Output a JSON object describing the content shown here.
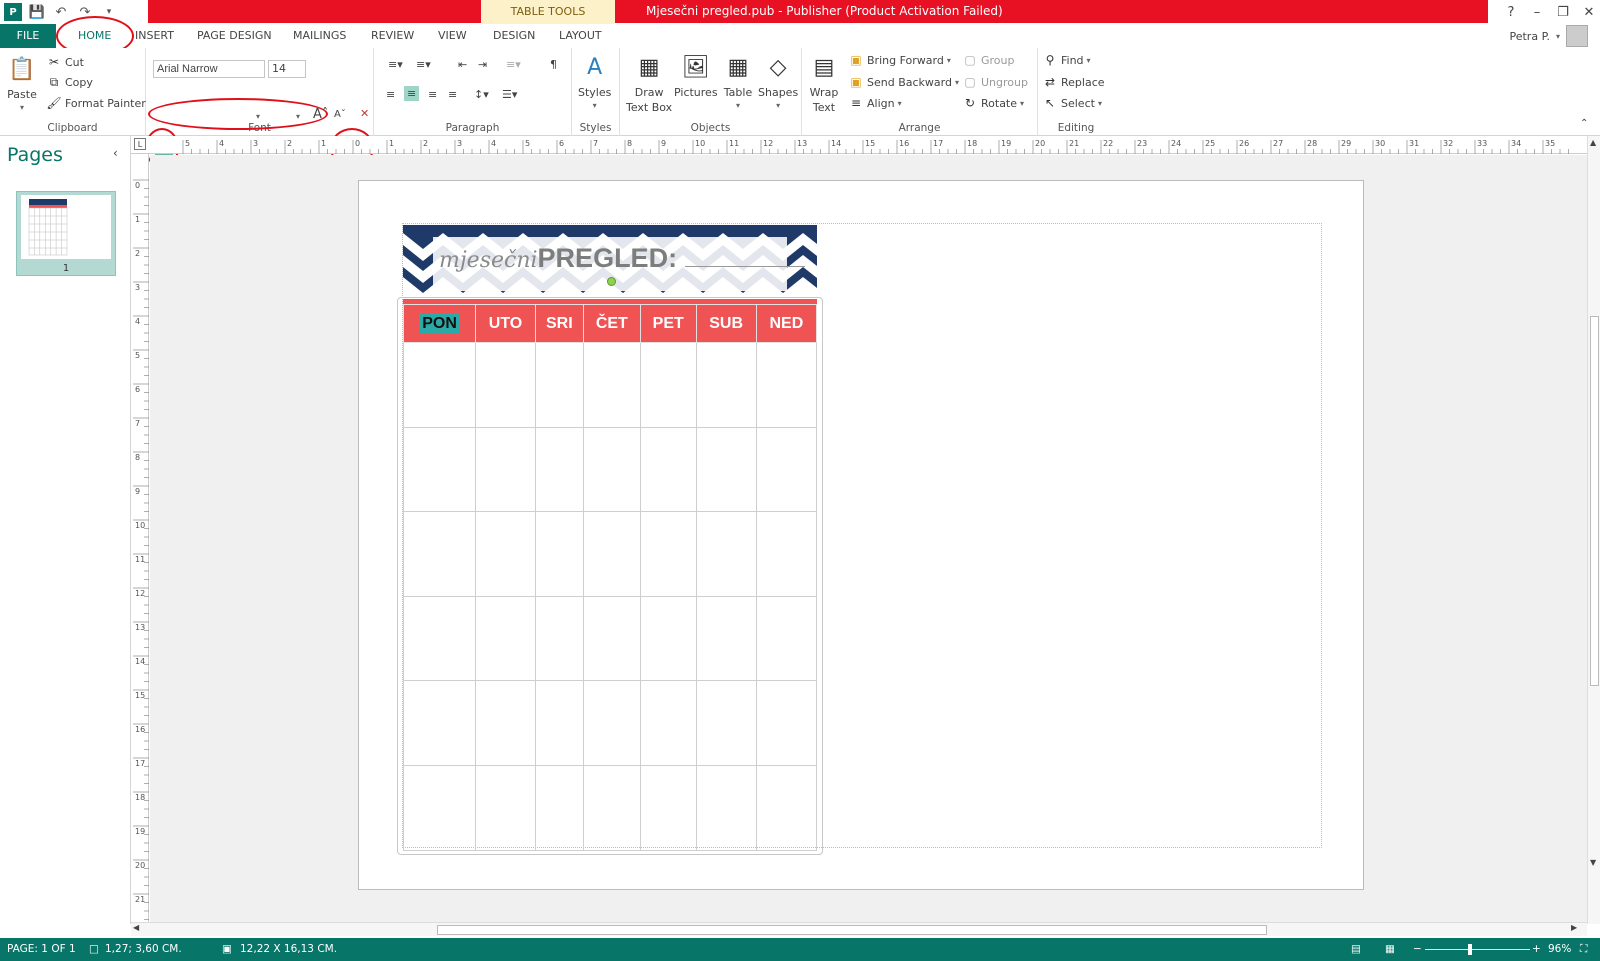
{
  "title_bar": {
    "context_tab": "TABLE TOOLS",
    "window_title": "Mjesečni pregled.pub -  Publisher (Product Activation Failed)",
    "help": "?",
    "minimize": "–",
    "restore": "❐",
    "close": "✕"
  },
  "tabs": [
    "FILE",
    "HOME",
    "INSERT",
    "PAGE DESIGN",
    "MAILINGS",
    "REVIEW",
    "VIEW",
    "DESIGN",
    "LAYOUT"
  ],
  "user": {
    "name": "Petra P."
  },
  "ribbon": {
    "clipboard": {
      "paste": "Paste",
      "cut": "Cut",
      "copy": "Copy",
      "format_painter": "Format Painter",
      "label": "Clipboard"
    },
    "font": {
      "name": "Arial Narrow",
      "size": "14",
      "label": "Font"
    },
    "paragraph": {
      "label": "Paragraph"
    },
    "styles": {
      "styles": "Styles",
      "label": "Styles"
    },
    "objects": {
      "draw_text_box_1": "Draw",
      "draw_text_box_2": "Text Box",
      "pictures": "Pictures",
      "table": "Table",
      "shapes": "Shapes",
      "label": "Objects"
    },
    "arrange": {
      "wrap_text_1": "Wrap",
      "wrap_text_2": "Text",
      "bring_forward": "Bring Forward",
      "send_backward": "Send Backward",
      "align": "Align",
      "group": "Group",
      "ungroup": "Ungroup",
      "rotate": "Rotate",
      "label": "Arrange"
    },
    "editing": {
      "find": "Find",
      "replace": "Replace",
      "select": "Select",
      "label": "Editing"
    }
  },
  "pages_panel": {
    "title": "Pages",
    "page_number": "1"
  },
  "ruler": {
    "h_labels": [
      "5",
      "4",
      "3",
      "2",
      "1",
      "0",
      "1",
      "2",
      "3",
      "4",
      "5",
      "6",
      "7",
      "8",
      "9",
      "10",
      "11",
      "12",
      "13",
      "14",
      "15",
      "16",
      "17",
      "18",
      "19",
      "20",
      "21",
      "22",
      "23",
      "24",
      "25",
      "26",
      "27",
      "28",
      "29",
      "30",
      "31",
      "32",
      "33",
      "34",
      "35"
    ],
    "v_labels": [
      "0",
      "1",
      "2",
      "3",
      "4",
      "5",
      "6",
      "7",
      "8",
      "9",
      "10",
      "11",
      "12",
      "13",
      "14",
      "15",
      "16",
      "17",
      "18",
      "19",
      "20",
      "21"
    ]
  },
  "document": {
    "banner_script": "mjesečni",
    "banner_bold": "PREGLED:",
    "days": [
      "PON",
      "UTO",
      "SRI",
      "ČET",
      "PET",
      "SUB",
      "NED"
    ],
    "rows": 6
  },
  "status_bar": {
    "page": "PAGE: 1 OF 1",
    "position": "1,27; 3,60 CM.",
    "size": "12,22 X 16,13 CM.",
    "zoom": "96%"
  },
  "colors": {
    "accent": "#077568",
    "title_red": "#e81123",
    "day_header": "#f05353",
    "chevron_navy": "#1f3a68",
    "highlight": "#2aa9a6"
  }
}
